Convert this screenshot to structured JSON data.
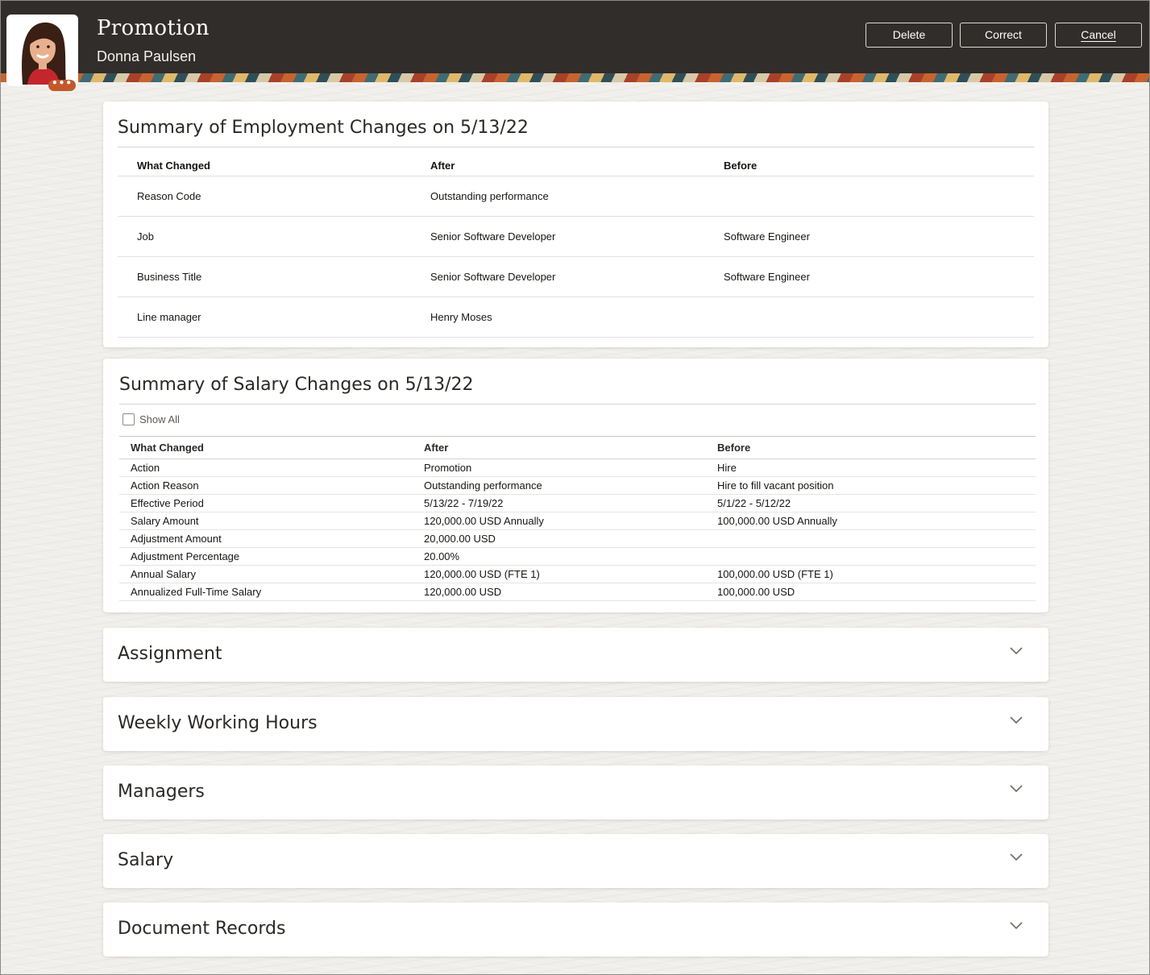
{
  "header": {
    "title": "Promotion",
    "person_name": "Donna Paulsen",
    "more_label": "•••",
    "buttons": {
      "delete": "Delete",
      "correct": "Correct",
      "cancel": "Cancel"
    }
  },
  "employment_summary": {
    "title": "Summary of Employment Changes on 5/13/22",
    "columns": [
      "What Changed",
      "After",
      "Before"
    ],
    "rows": [
      {
        "what": "Reason Code",
        "after": "Outstanding performance",
        "before": ""
      },
      {
        "what": "Job",
        "after": "Senior Software Developer",
        "before": "Software Engineer"
      },
      {
        "what": "Business Title",
        "after": "Senior Software Developer",
        "before": "Software Engineer"
      },
      {
        "what": "Line manager",
        "after": "Henry Moses",
        "before": ""
      }
    ]
  },
  "salary_summary": {
    "title": "Summary of Salary Changes on 5/13/22",
    "show_all_label": "Show All",
    "columns": [
      "What Changed",
      "After",
      "Before"
    ],
    "rows": [
      {
        "what": "Action",
        "after": "Promotion",
        "before": "Hire"
      },
      {
        "what": "Action Reason",
        "after": "Outstanding performance",
        "before": "Hire to fill vacant position"
      },
      {
        "what": "Effective Period",
        "after": "5/13/22 - 7/19/22",
        "before": "5/1/22 - 5/12/22"
      },
      {
        "what": "Salary Amount",
        "after": "120,000.00 USD Annually",
        "before": "100,000.00 USD Annually"
      },
      {
        "what": "Adjustment Amount",
        "after": "20,000.00 USD",
        "before": ""
      },
      {
        "what": "Adjustment Percentage",
        "after": "20.00%",
        "before": ""
      },
      {
        "what": "Annual Salary",
        "after": "120,000.00 USD (FTE 1)",
        "before": "100,000.00 USD (FTE 1)"
      },
      {
        "what": "Annualized Full-Time Salary",
        "after": "120,000.00 USD",
        "before": "100,000.00 USD"
      }
    ]
  },
  "sections": [
    {
      "title": "Assignment"
    },
    {
      "title": "Weekly Working Hours"
    },
    {
      "title": "Managers"
    },
    {
      "title": "Salary"
    },
    {
      "title": "Document Records"
    }
  ],
  "icons": {
    "expand": "chevron-down-icon"
  }
}
